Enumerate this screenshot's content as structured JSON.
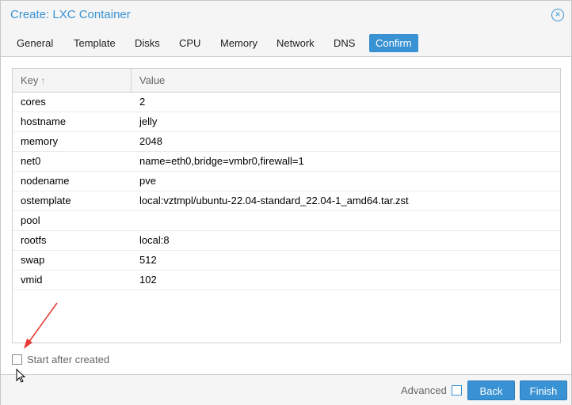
{
  "window": {
    "title": "Create: LXC Container"
  },
  "tabs": [
    {
      "label": "General"
    },
    {
      "label": "Template"
    },
    {
      "label": "Disks"
    },
    {
      "label": "CPU"
    },
    {
      "label": "Memory"
    },
    {
      "label": "Network"
    },
    {
      "label": "DNS"
    },
    {
      "label": "Confirm",
      "active": true
    }
  ],
  "grid": {
    "columns": {
      "key": "Key",
      "value": "Value"
    },
    "sort": {
      "column": "Key",
      "direction": "ascending"
    },
    "rows": [
      {
        "key": "cores",
        "value": "2"
      },
      {
        "key": "hostname",
        "value": "jelly"
      },
      {
        "key": "memory",
        "value": "2048"
      },
      {
        "key": "net0",
        "value": "name=eth0,bridge=vmbr0,firewall=1"
      },
      {
        "key": "nodename",
        "value": "pve"
      },
      {
        "key": "ostemplate",
        "value": "local:vztmpl/ubuntu-22.04-standard_22.04-1_amd64.tar.zst"
      },
      {
        "key": "pool",
        "value": ""
      },
      {
        "key": "rootfs",
        "value": "local:8"
      },
      {
        "key": "swap",
        "value": "512"
      },
      {
        "key": "vmid",
        "value": "102"
      }
    ]
  },
  "start_after_created": {
    "label": "Start after created",
    "checked": false
  },
  "footer": {
    "advanced_label": "Advanced",
    "advanced_checked": false,
    "back_label": "Back",
    "finish_label": "Finish"
  },
  "colors": {
    "accent": "#3892d4",
    "annotation_arrow": "#e53935"
  },
  "icons": {
    "close": "close-circle-icon",
    "sort": "sort-ascending-icon",
    "cursor": "mouse-pointer-icon"
  }
}
